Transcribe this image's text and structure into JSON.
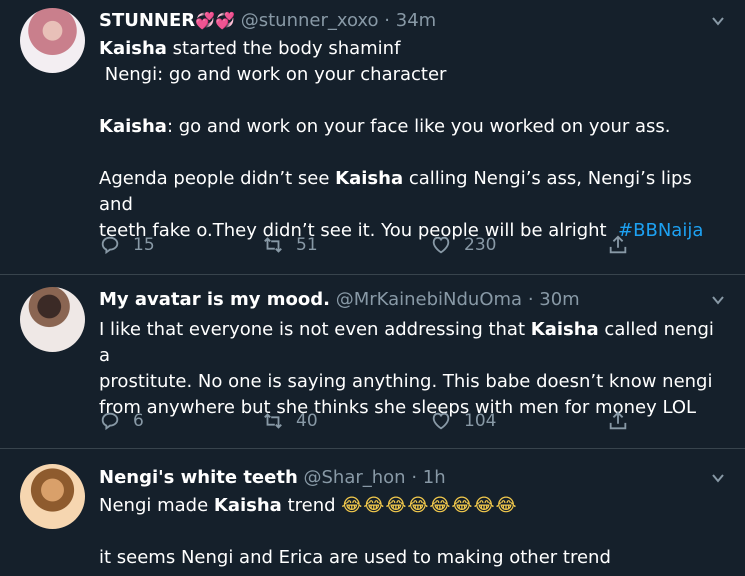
{
  "tweets": [
    {
      "display_name": "STUNNER",
      "name_emoji": "💞💞",
      "handle": "@stunner_xoxo",
      "time": "34m",
      "lines": [
        {
          "parts": [
            {
              "text": "Kaisha",
              "bold": true
            },
            {
              "text": " started the body shaminf"
            }
          ]
        },
        {
          "parts": [
            {
              "text": " Nengi: go and work on your character"
            }
          ]
        },
        {
          "parts": [
            {
              "text": ""
            }
          ]
        },
        {
          "parts": [
            {
              "text": "Kaisha",
              "bold": true
            },
            {
              "text": ": go and work on your face like you worked on your ass."
            }
          ]
        },
        {
          "parts": [
            {
              "text": ""
            }
          ]
        },
        {
          "parts": [
            {
              "text": "Agenda people didn’t see "
            },
            {
              "text": "Kaisha",
              "bold": true
            },
            {
              "text": " calling Nengi’s ass, Nengi’s lips and"
            }
          ]
        },
        {
          "parts": [
            {
              "text": "teeth fake o.They didn’t see it. You people will be alright  "
            },
            {
              "text": "#BBNaija",
              "link": true
            }
          ]
        }
      ],
      "replies": "15",
      "retweets": "51",
      "likes": "230"
    },
    {
      "display_name": "My avatar is my mood.",
      "handle": "@MrKainebiNduOma",
      "time": "30m",
      "lines": [
        {
          "parts": [
            {
              "text": "I like that everyone is not even addressing that "
            },
            {
              "text": "Kaisha",
              "bold": true
            },
            {
              "text": " called nengi a"
            }
          ]
        },
        {
          "parts": [
            {
              "text": "prostitute. No one is saying anything. This babe doesn’t know nengi"
            }
          ]
        },
        {
          "parts": [
            {
              "text": "from anywhere but she thinks she sleeps with men for money LOL"
            }
          ]
        }
      ],
      "replies": "6",
      "retweets": "40",
      "likes": "104"
    },
    {
      "display_name": "Nengi's white teeth",
      "handle": "@Shar_hon",
      "time": "1h",
      "lines": [
        {
          "parts": [
            {
              "text": "Nengi made "
            },
            {
              "text": "Kaisha",
              "bold": true
            },
            {
              "text": " trend "
            },
            {
              "text": "😂😂😂😂😂😂😂😂",
              "emoji": true
            }
          ]
        },
        {
          "parts": [
            {
              "text": ""
            }
          ]
        },
        {
          "parts": [
            {
              "text": "it seems Nengi and Erica are used to making other trend"
            }
          ]
        }
      ]
    }
  ],
  "separator": "·",
  "colors": {
    "background": "#15202b",
    "secondary_text": "#8899a6",
    "link": "#1da1f2",
    "divider": "#38444d"
  }
}
